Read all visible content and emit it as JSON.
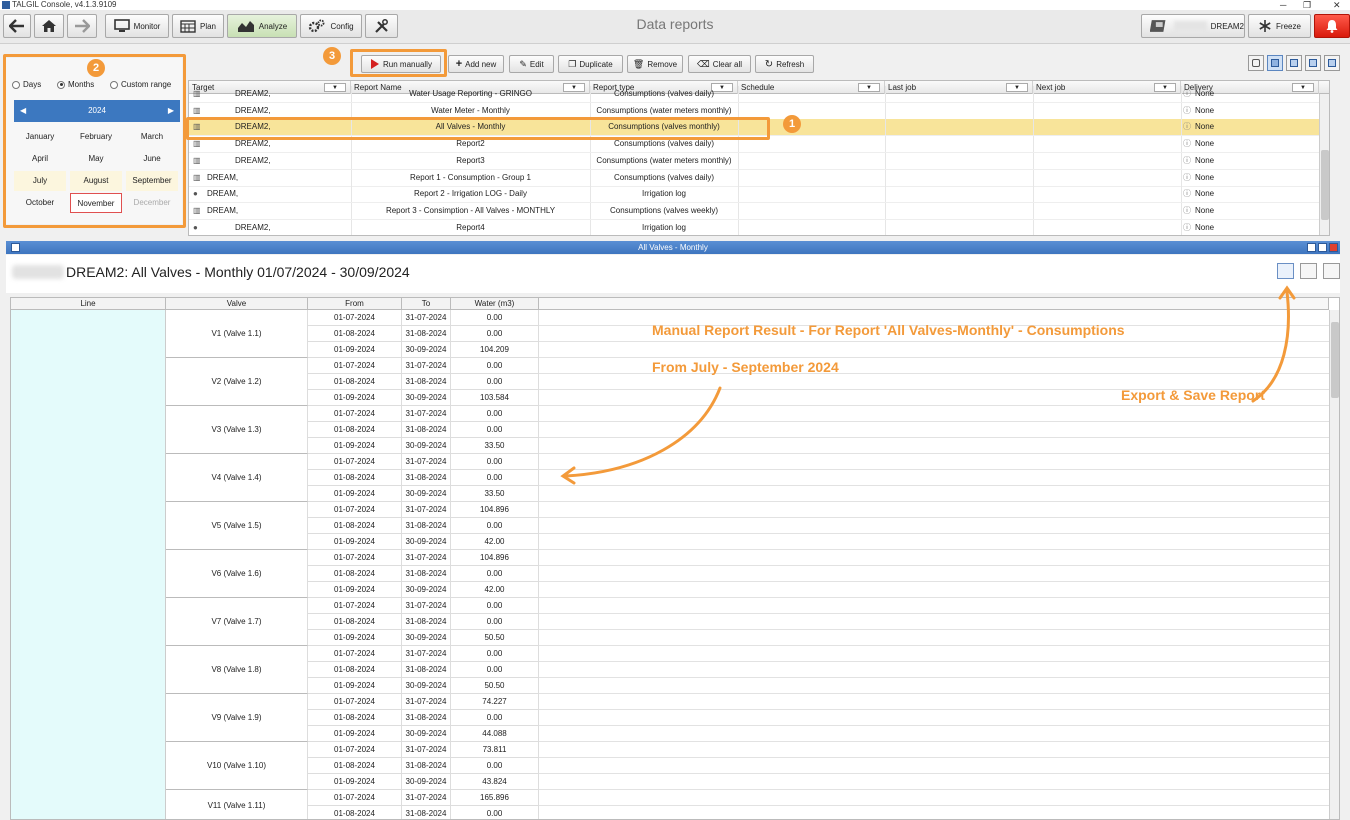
{
  "window": {
    "title": "TALGIL Console, v4.1.3.9109"
  },
  "toolbar": {
    "monitor": "Monitor",
    "plan": "Plan",
    "analyze": "Analyze",
    "config": "Config",
    "page_title": "Data reports",
    "controller": "DREAM2",
    "freeze": "Freeze"
  },
  "period": {
    "days": "Days",
    "months": "Months",
    "custom": "Custom range",
    "selected_mode": "Months",
    "year": "2024",
    "months_list": [
      "January",
      "February",
      "March",
      "April",
      "May",
      "June",
      "July",
      "August",
      "September",
      "October",
      "November",
      "December"
    ],
    "selected_month": "November"
  },
  "actions": {
    "run_manually": "Run manually",
    "add_new": "Add new",
    "edit": "Edit",
    "duplicate": "Duplicate",
    "remove": "Remove",
    "clear_all": "Clear all",
    "refresh": "Refresh"
  },
  "reports": {
    "columns": [
      "Target",
      "Report Name",
      "Report type",
      "Schedule",
      "Last job",
      "Next job",
      "Delivery"
    ],
    "rows": [
      {
        "target": "DREAM2,",
        "name": "Water Usage Reporting - GRINGO",
        "type": "Consumptions (valves daily)",
        "delivery": "None",
        "icon": "chart"
      },
      {
        "target": "DREAM2,",
        "name": "Water Meter - Monthly",
        "type": "Consumptions (water meters monthly)",
        "delivery": "None",
        "icon": "chart"
      },
      {
        "target": "DREAM2,",
        "name": "All Valves - Monthly",
        "type": "Consumptions (valves monthly)",
        "delivery": "None",
        "icon": "chart",
        "selected": true
      },
      {
        "target": "DREAM2,",
        "name": "Report2",
        "type": "Consumptions (valves daily)",
        "delivery": "None",
        "icon": "chart"
      },
      {
        "target": "DREAM2,",
        "name": "Report3",
        "type": "Consumptions (water meters monthly)",
        "delivery": "None",
        "icon": "chart"
      },
      {
        "target": "DREAM,",
        "name": "Report 1 - Consumption - Group 1",
        "type": "Consumptions (valves daily)",
        "delivery": "None",
        "icon": "chart"
      },
      {
        "target": "DREAM,",
        "name": "Report 2 - Irrigation LOG - Daily",
        "type": "Irrigation log",
        "delivery": "None",
        "icon": "drop"
      },
      {
        "target": "DREAM,",
        "name": "Report 3 - Consimption - All Valves - MONTHLY",
        "type": "Consumptions (valves weekly)",
        "delivery": "None",
        "icon": "chart"
      },
      {
        "target": "DREAM2,",
        "name": "Report4",
        "type": "Irrigation log",
        "delivery": "None",
        "icon": "drop"
      }
    ]
  },
  "details": {
    "window_title": "All Valves - Monthly",
    "heading": "DREAM2: All Valves - Monthly 01/07/2024 - 30/09/2024",
    "columns": [
      "Line",
      "Valve",
      "From",
      "To",
      "Water (m3)"
    ],
    "groups": [
      {
        "valve": "V1 (Valve 1.1)",
        "rows": [
          [
            "01-07-2024",
            "31-07-2024",
            "0.00"
          ],
          [
            "01-08-2024",
            "31-08-2024",
            "0.00"
          ],
          [
            "01-09-2024",
            "30-09-2024",
            "104.209"
          ]
        ]
      },
      {
        "valve": "V2 (Valve 1.2)",
        "rows": [
          [
            "01-07-2024",
            "31-07-2024",
            "0.00"
          ],
          [
            "01-08-2024",
            "31-08-2024",
            "0.00"
          ],
          [
            "01-09-2024",
            "30-09-2024",
            "103.584"
          ]
        ]
      },
      {
        "valve": "V3 (Valve 1.3)",
        "rows": [
          [
            "01-07-2024",
            "31-07-2024",
            "0.00"
          ],
          [
            "01-08-2024",
            "31-08-2024",
            "0.00"
          ],
          [
            "01-09-2024",
            "30-09-2024",
            "33.50"
          ]
        ]
      },
      {
        "valve": "V4 (Valve 1.4)",
        "rows": [
          [
            "01-07-2024",
            "31-07-2024",
            "0.00"
          ],
          [
            "01-08-2024",
            "31-08-2024",
            "0.00"
          ],
          [
            "01-09-2024",
            "30-09-2024",
            "33.50"
          ]
        ]
      },
      {
        "valve": "V5 (Valve 1.5)",
        "rows": [
          [
            "01-07-2024",
            "31-07-2024",
            "104.896"
          ],
          [
            "01-08-2024",
            "31-08-2024",
            "0.00"
          ],
          [
            "01-09-2024",
            "30-09-2024",
            "42.00"
          ]
        ]
      },
      {
        "valve": "V6 (Valve 1.6)",
        "rows": [
          [
            "01-07-2024",
            "31-07-2024",
            "104.896"
          ],
          [
            "01-08-2024",
            "31-08-2024",
            "0.00"
          ],
          [
            "01-09-2024",
            "30-09-2024",
            "42.00"
          ]
        ]
      },
      {
        "valve": "V7 (Valve 1.7)",
        "rows": [
          [
            "01-07-2024",
            "31-07-2024",
            "0.00"
          ],
          [
            "01-08-2024",
            "31-08-2024",
            "0.00"
          ],
          [
            "01-09-2024",
            "30-09-2024",
            "50.50"
          ]
        ]
      },
      {
        "valve": "V8 (Valve 1.8)",
        "rows": [
          [
            "01-07-2024",
            "31-07-2024",
            "0.00"
          ],
          [
            "01-08-2024",
            "31-08-2024",
            "0.00"
          ],
          [
            "01-09-2024",
            "30-09-2024",
            "50.50"
          ]
        ]
      },
      {
        "valve": "V9 (Valve 1.9)",
        "rows": [
          [
            "01-07-2024",
            "31-07-2024",
            "74.227"
          ],
          [
            "01-08-2024",
            "31-08-2024",
            "0.00"
          ],
          [
            "01-09-2024",
            "30-09-2024",
            "44.088"
          ]
        ]
      },
      {
        "valve": "V10 (Valve 1.10)",
        "rows": [
          [
            "01-07-2024",
            "31-07-2024",
            "73.811"
          ],
          [
            "01-08-2024",
            "31-08-2024",
            "0.00"
          ],
          [
            "01-09-2024",
            "30-09-2024",
            "43.824"
          ]
        ]
      },
      {
        "valve": "V11 (Valve 1.11)",
        "rows": [
          [
            "01-07-2024",
            "31-07-2024",
            "165.896"
          ],
          [
            "01-08-2024",
            "31-08-2024",
            "0.00"
          ]
        ]
      }
    ]
  },
  "annotations": {
    "badge1": "1",
    "badge2": "2",
    "badge3": "3",
    "result_text": "Manual Report Result - For Report 'All Valves-Monthly' - Consumptions",
    "range_text": "From July - September 2024",
    "export_text": "Export & Save Report"
  },
  "colors": {
    "accent": "#f39a3a",
    "selected_row": "#f8e49a",
    "line_column": "#e4fbfb",
    "header_blue": "#3c78c0"
  }
}
